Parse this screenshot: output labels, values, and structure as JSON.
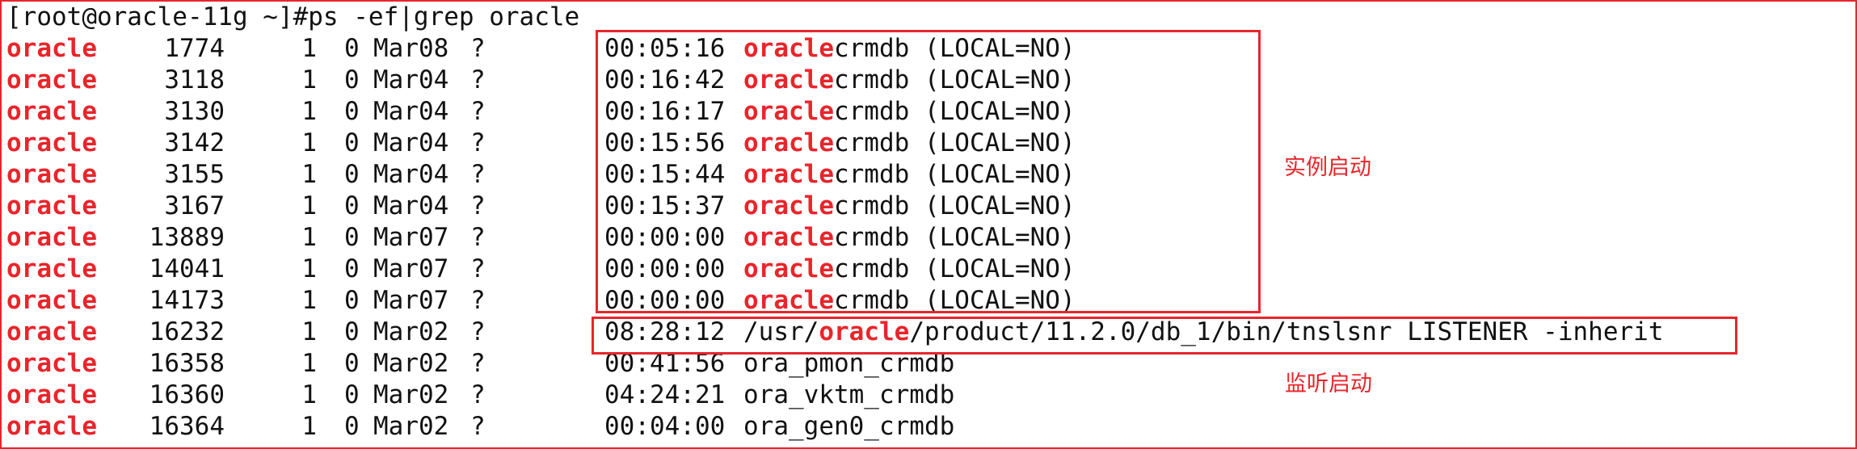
{
  "terminal": {
    "prompt": "[root@oracle-11g ~]#ps -ef|grep oracle",
    "highlight_color": "#e8252b",
    "rows": [
      {
        "user": "oracle",
        "pid": "1774",
        "ppid": "1",
        "c": "0",
        "stime": "Mar08",
        "tty": "?",
        "time": "00:05:16",
        "cmd_pre": "",
        "cmd_hl": "oracle",
        "cmd_post": "crmdb (LOCAL=NO)"
      },
      {
        "user": "oracle",
        "pid": "3118",
        "ppid": "1",
        "c": "0",
        "stime": "Mar04",
        "tty": "?",
        "time": "00:16:42",
        "cmd_pre": "",
        "cmd_hl": "oracle",
        "cmd_post": "crmdb (LOCAL=NO)"
      },
      {
        "user": "oracle",
        "pid": "3130",
        "ppid": "1",
        "c": "0",
        "stime": "Mar04",
        "tty": "?",
        "time": "00:16:17",
        "cmd_pre": "",
        "cmd_hl": "oracle",
        "cmd_post": "crmdb (LOCAL=NO)"
      },
      {
        "user": "oracle",
        "pid": "3142",
        "ppid": "1",
        "c": "0",
        "stime": "Mar04",
        "tty": "?",
        "time": "00:15:56",
        "cmd_pre": "",
        "cmd_hl": "oracle",
        "cmd_post": "crmdb (LOCAL=NO)"
      },
      {
        "user": "oracle",
        "pid": "3155",
        "ppid": "1",
        "c": "0",
        "stime": "Mar04",
        "tty": "?",
        "time": "00:15:44",
        "cmd_pre": "",
        "cmd_hl": "oracle",
        "cmd_post": "crmdb (LOCAL=NO)"
      },
      {
        "user": "oracle",
        "pid": "3167",
        "ppid": "1",
        "c": "0",
        "stime": "Mar04",
        "tty": "?",
        "time": "00:15:37",
        "cmd_pre": "",
        "cmd_hl": "oracle",
        "cmd_post": "crmdb (LOCAL=NO)"
      },
      {
        "user": "oracle",
        "pid": "13889",
        "ppid": "1",
        "c": "0",
        "stime": "Mar07",
        "tty": "?",
        "time": "00:00:00",
        "cmd_pre": "",
        "cmd_hl": "oracle",
        "cmd_post": "crmdb (LOCAL=NO)"
      },
      {
        "user": "oracle",
        "pid": "14041",
        "ppid": "1",
        "c": "0",
        "stime": "Mar07",
        "tty": "?",
        "time": "00:00:00",
        "cmd_pre": "",
        "cmd_hl": "oracle",
        "cmd_post": "crmdb (LOCAL=NO)"
      },
      {
        "user": "oracle",
        "pid": "14173",
        "ppid": "1",
        "c": "0",
        "stime": "Mar07",
        "tty": "?",
        "time": "00:00:00",
        "cmd_pre": "",
        "cmd_hl": "oracle",
        "cmd_post": "crmdb (LOCAL=NO)"
      },
      {
        "user": "oracle",
        "pid": "16232",
        "ppid": "1",
        "c": "0",
        "stime": "Mar02",
        "tty": "?",
        "time": "08:28:12",
        "cmd_pre": "/usr/",
        "cmd_hl": "oracle",
        "cmd_post": "/product/11.2.0/db_1/bin/tnslsnr LISTENER -inherit"
      },
      {
        "user": "oracle",
        "pid": "16358",
        "ppid": "1",
        "c": "0",
        "stime": "Mar02",
        "tty": "?",
        "time": "00:41:56",
        "cmd_pre": "ora_pmon_crmdb",
        "cmd_hl": "",
        "cmd_post": ""
      },
      {
        "user": "oracle",
        "pid": "16360",
        "ppid": "1",
        "c": "0",
        "stime": "Mar02",
        "tty": "?",
        "time": "04:24:21",
        "cmd_pre": "ora_vktm_crmdb",
        "cmd_hl": "",
        "cmd_post": ""
      },
      {
        "user": "oracle",
        "pid": "16364",
        "ppid": "1",
        "c": "0",
        "stime": "Mar02",
        "tty": "?",
        "time": "00:04:00",
        "cmd_pre": "ora_gen0_crmdb",
        "cmd_hl": "",
        "cmd_post": ""
      }
    ]
  },
  "annotations": {
    "instance_label": "实例启动",
    "listener_label": "监听启动"
  }
}
